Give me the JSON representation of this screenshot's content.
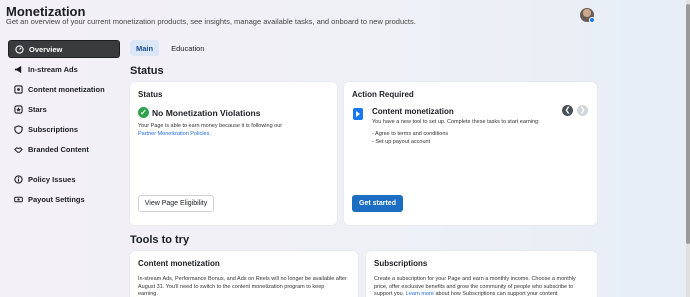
{
  "header": {
    "title": "Monetization",
    "subtitle": "Get an overview of your current monetization products, see insights, manage available tasks, and onboard to new products."
  },
  "sidebar": {
    "items": [
      {
        "label": "Overview",
        "icon": "gauge-icon",
        "active": true
      },
      {
        "label": "In-stream Ads",
        "icon": "megaphone-icon"
      },
      {
        "label": "Content monetization",
        "icon": "content-monetization-icon"
      },
      {
        "label": "Stars",
        "icon": "star-icon"
      },
      {
        "label": "Subscriptions",
        "icon": "shield-icon"
      },
      {
        "label": "Branded Content",
        "icon": "handshake-icon"
      },
      {
        "label": "Policy Issues",
        "icon": "info-icon"
      },
      {
        "label": "Payout Settings",
        "icon": "money-icon"
      }
    ]
  },
  "tabs": [
    {
      "label": "Main",
      "active": true
    },
    {
      "label": "Education"
    }
  ],
  "status": {
    "section_title": "Status",
    "card_title": "Status",
    "violation_title": "No Monetization Violations",
    "violation_desc": "Your Page is able to earn money because it is following our",
    "policy_link": "Partner Monetization Policies.",
    "button": "View Page Eligibility"
  },
  "action": {
    "card_title": "Action Required",
    "item_title": "Content monetization",
    "item_desc": "You have a new tool to set up. Complete these tasks to start earning:",
    "tasks": [
      "- Agree to terms and conditions",
      "- Set up payout account"
    ],
    "button": "Get started"
  },
  "tools": {
    "section_title": "Tools to try",
    "content_monetization": {
      "title": "Content monetization",
      "desc_line1": "In-stream Ads, Performance Bonus, and Ads on Reels will no longer be available after",
      "desc_line2": "August 31. You'll need to switch to the content monetization program to keep",
      "desc_line3": "earning."
    },
    "subscriptions": {
      "title": "Subscriptions",
      "desc_line1": "Create a subscription for your Page and earn a monthly income. Choose a monthly",
      "desc_line2": "price, offer exclusive benefits and grow the community of people who subscribe to",
      "desc_line3_pre": "support you. ",
      "desc_link": "Learn more",
      "desc_line3_post": " about how Subscriptions can support your content"
    }
  },
  "colors": {
    "accent": "#1b6ec2",
    "success": "#31a24c",
    "link": "#216fdb"
  }
}
